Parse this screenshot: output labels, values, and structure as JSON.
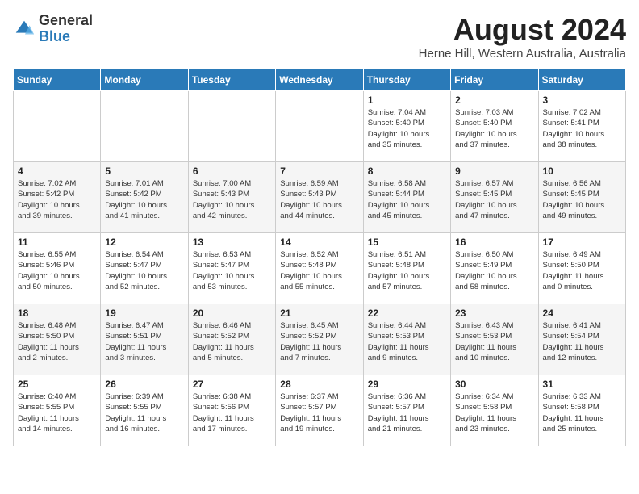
{
  "header": {
    "logo_general": "General",
    "logo_blue": "Blue",
    "month_title": "August 2024",
    "subtitle": "Herne Hill, Western Australia, Australia"
  },
  "days_of_week": [
    "Sunday",
    "Monday",
    "Tuesday",
    "Wednesday",
    "Thursday",
    "Friday",
    "Saturday"
  ],
  "weeks": [
    [
      {
        "num": "",
        "info": ""
      },
      {
        "num": "",
        "info": ""
      },
      {
        "num": "",
        "info": ""
      },
      {
        "num": "",
        "info": ""
      },
      {
        "num": "1",
        "info": "Sunrise: 7:04 AM\nSunset: 5:40 PM\nDaylight: 10 hours\nand 35 minutes."
      },
      {
        "num": "2",
        "info": "Sunrise: 7:03 AM\nSunset: 5:40 PM\nDaylight: 10 hours\nand 37 minutes."
      },
      {
        "num": "3",
        "info": "Sunrise: 7:02 AM\nSunset: 5:41 PM\nDaylight: 10 hours\nand 38 minutes."
      }
    ],
    [
      {
        "num": "4",
        "info": "Sunrise: 7:02 AM\nSunset: 5:42 PM\nDaylight: 10 hours\nand 39 minutes."
      },
      {
        "num": "5",
        "info": "Sunrise: 7:01 AM\nSunset: 5:42 PM\nDaylight: 10 hours\nand 41 minutes."
      },
      {
        "num": "6",
        "info": "Sunrise: 7:00 AM\nSunset: 5:43 PM\nDaylight: 10 hours\nand 42 minutes."
      },
      {
        "num": "7",
        "info": "Sunrise: 6:59 AM\nSunset: 5:43 PM\nDaylight: 10 hours\nand 44 minutes."
      },
      {
        "num": "8",
        "info": "Sunrise: 6:58 AM\nSunset: 5:44 PM\nDaylight: 10 hours\nand 45 minutes."
      },
      {
        "num": "9",
        "info": "Sunrise: 6:57 AM\nSunset: 5:45 PM\nDaylight: 10 hours\nand 47 minutes."
      },
      {
        "num": "10",
        "info": "Sunrise: 6:56 AM\nSunset: 5:45 PM\nDaylight: 10 hours\nand 49 minutes."
      }
    ],
    [
      {
        "num": "11",
        "info": "Sunrise: 6:55 AM\nSunset: 5:46 PM\nDaylight: 10 hours\nand 50 minutes."
      },
      {
        "num": "12",
        "info": "Sunrise: 6:54 AM\nSunset: 5:47 PM\nDaylight: 10 hours\nand 52 minutes."
      },
      {
        "num": "13",
        "info": "Sunrise: 6:53 AM\nSunset: 5:47 PM\nDaylight: 10 hours\nand 53 minutes."
      },
      {
        "num": "14",
        "info": "Sunrise: 6:52 AM\nSunset: 5:48 PM\nDaylight: 10 hours\nand 55 minutes."
      },
      {
        "num": "15",
        "info": "Sunrise: 6:51 AM\nSunset: 5:48 PM\nDaylight: 10 hours\nand 57 minutes."
      },
      {
        "num": "16",
        "info": "Sunrise: 6:50 AM\nSunset: 5:49 PM\nDaylight: 10 hours\nand 58 minutes."
      },
      {
        "num": "17",
        "info": "Sunrise: 6:49 AM\nSunset: 5:50 PM\nDaylight: 11 hours\nand 0 minutes."
      }
    ],
    [
      {
        "num": "18",
        "info": "Sunrise: 6:48 AM\nSunset: 5:50 PM\nDaylight: 11 hours\nand 2 minutes."
      },
      {
        "num": "19",
        "info": "Sunrise: 6:47 AM\nSunset: 5:51 PM\nDaylight: 11 hours\nand 3 minutes."
      },
      {
        "num": "20",
        "info": "Sunrise: 6:46 AM\nSunset: 5:52 PM\nDaylight: 11 hours\nand 5 minutes."
      },
      {
        "num": "21",
        "info": "Sunrise: 6:45 AM\nSunset: 5:52 PM\nDaylight: 11 hours\nand 7 minutes."
      },
      {
        "num": "22",
        "info": "Sunrise: 6:44 AM\nSunset: 5:53 PM\nDaylight: 11 hours\nand 9 minutes."
      },
      {
        "num": "23",
        "info": "Sunrise: 6:43 AM\nSunset: 5:53 PM\nDaylight: 11 hours\nand 10 minutes."
      },
      {
        "num": "24",
        "info": "Sunrise: 6:41 AM\nSunset: 5:54 PM\nDaylight: 11 hours\nand 12 minutes."
      }
    ],
    [
      {
        "num": "25",
        "info": "Sunrise: 6:40 AM\nSunset: 5:55 PM\nDaylight: 11 hours\nand 14 minutes."
      },
      {
        "num": "26",
        "info": "Sunrise: 6:39 AM\nSunset: 5:55 PM\nDaylight: 11 hours\nand 16 minutes."
      },
      {
        "num": "27",
        "info": "Sunrise: 6:38 AM\nSunset: 5:56 PM\nDaylight: 11 hours\nand 17 minutes."
      },
      {
        "num": "28",
        "info": "Sunrise: 6:37 AM\nSunset: 5:57 PM\nDaylight: 11 hours\nand 19 minutes."
      },
      {
        "num": "29",
        "info": "Sunrise: 6:36 AM\nSunset: 5:57 PM\nDaylight: 11 hours\nand 21 minutes."
      },
      {
        "num": "30",
        "info": "Sunrise: 6:34 AM\nSunset: 5:58 PM\nDaylight: 11 hours\nand 23 minutes."
      },
      {
        "num": "31",
        "info": "Sunrise: 6:33 AM\nSunset: 5:58 PM\nDaylight: 11 hours\nand 25 minutes."
      }
    ]
  ]
}
